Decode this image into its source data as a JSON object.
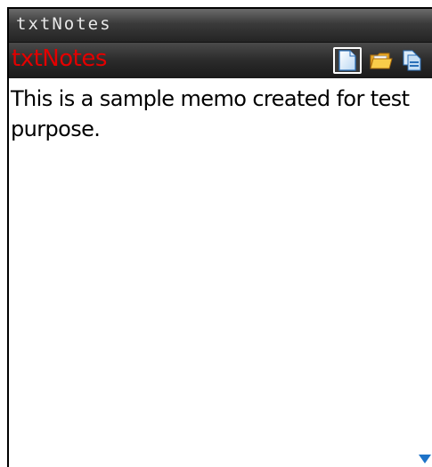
{
  "window": {
    "title": "txtNotes"
  },
  "toolbar": {
    "title": "txtNotes",
    "buttons": [
      {
        "name": "new-note",
        "icon": "document-icon"
      },
      {
        "name": "open-note",
        "icon": "folder-icon"
      },
      {
        "name": "save-note",
        "icon": "copy-icon"
      }
    ]
  },
  "editor": {
    "text": "This is a sample memo created for test purpose."
  },
  "colors": {
    "title_red": "#e20000",
    "scroll_arrow": "#1e73c8"
  }
}
